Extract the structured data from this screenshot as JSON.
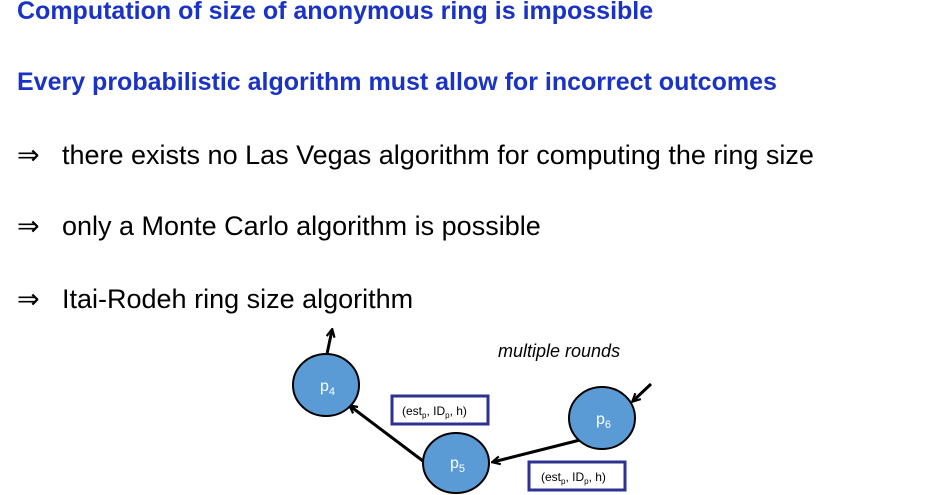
{
  "headings": [
    "Computation of size of anonymous ring is impossible",
    "Every probabilistic algorithm must allow for incorrect outcomes"
  ],
  "bullet_symbol": "⇒",
  "bullets": [
    "there exists no Las Vegas algorithm for computing the ring size",
    "only a Monte Carlo algorithm is possible",
    "Itai-Rodeh ring size algorithm"
  ],
  "diagram": {
    "caption": "multiple rounds",
    "nodes": [
      {
        "base": "p",
        "sub": "4"
      },
      {
        "base": "p",
        "sub": "5"
      },
      {
        "base": "p",
        "sub": "6"
      }
    ],
    "messages": [
      {
        "parts": [
          "(est",
          "p",
          ", ID",
          "p",
          ", h)"
        ]
      },
      {
        "parts": [
          "(est",
          "p",
          ", ID",
          "p",
          ", h)"
        ]
      }
    ],
    "colors": {
      "node_fill": "#5b9bd5",
      "node_stroke": "#000000",
      "message_border": "#2e3192",
      "heading": "#1a33c6"
    }
  }
}
